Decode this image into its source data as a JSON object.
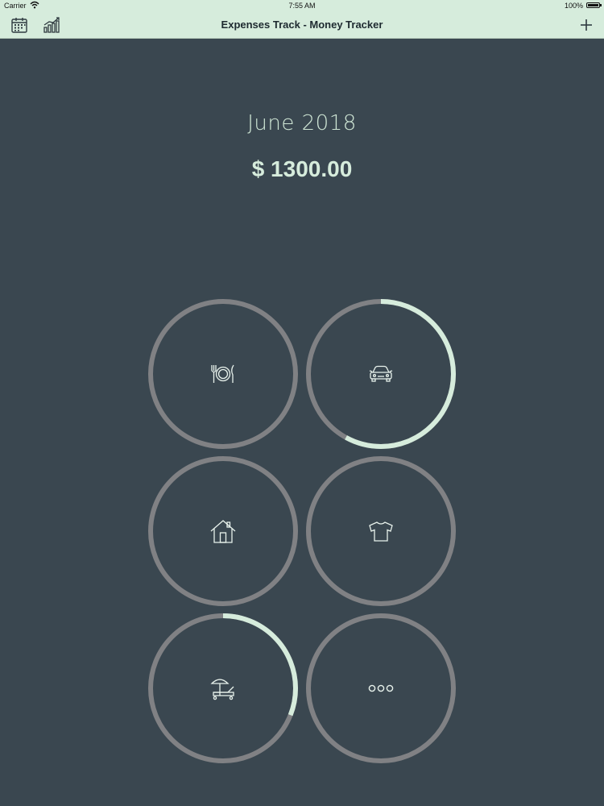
{
  "status_bar": {
    "carrier": "Carrier",
    "time": "7:55 AM",
    "battery": "100%"
  },
  "nav": {
    "title": "Expenses Track - Money Tracker",
    "left_icons": [
      "calendar-icon",
      "chart-icon"
    ],
    "right_icon": "plus-icon"
  },
  "summary": {
    "month": "June 2018",
    "total": "$ 1300.00"
  },
  "colors": {
    "background": "#3a4750",
    "bar": "#d6ecdc",
    "ring_track": "#808184",
    "ring_progress": "#d6ecdc",
    "icon": "#e8f2ec"
  },
  "categories": [
    {
      "icon": "utensils-plate-icon",
      "progress": 0
    },
    {
      "icon": "car-icon",
      "progress": 0.58
    },
    {
      "icon": "house-icon",
      "progress": 0
    },
    {
      "icon": "tshirt-icon",
      "progress": 0
    },
    {
      "icon": "beach-chair-icon",
      "progress": 0.31
    },
    {
      "icon": "more-icon",
      "progress": 0
    }
  ]
}
